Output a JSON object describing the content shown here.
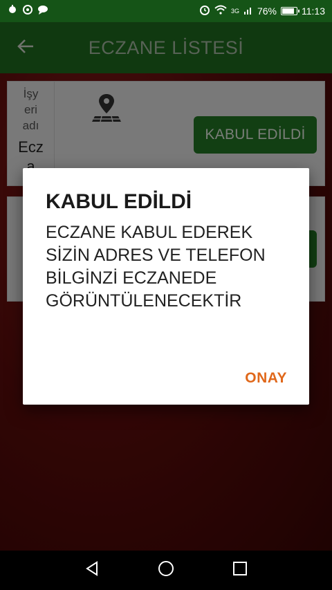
{
  "status_bar": {
    "battery_percent": "76%",
    "time": "11:13",
    "network": "3G",
    "battery_level": 0.76
  },
  "app_bar": {
    "title": "ECZANE LİSTESİ"
  },
  "list": {
    "card1": {
      "label_top": "İşy\neri\nadı",
      "label_value": "Ecz\na",
      "accept_label": "KABUL EDİLDİ"
    }
  },
  "dialog": {
    "title": "KABUL EDİLDİ",
    "message": "ECZANE KABUL EDEREK SİZİN ADRES VE TELEFON BİLGİNZİ ECZANEDE GÖRÜNTÜLENECEKTİR",
    "confirm_label": "ONAY"
  },
  "colors": {
    "app_bar": "#1f6e20",
    "accent_button": "#237a25",
    "dialog_action": "#e0681b"
  }
}
